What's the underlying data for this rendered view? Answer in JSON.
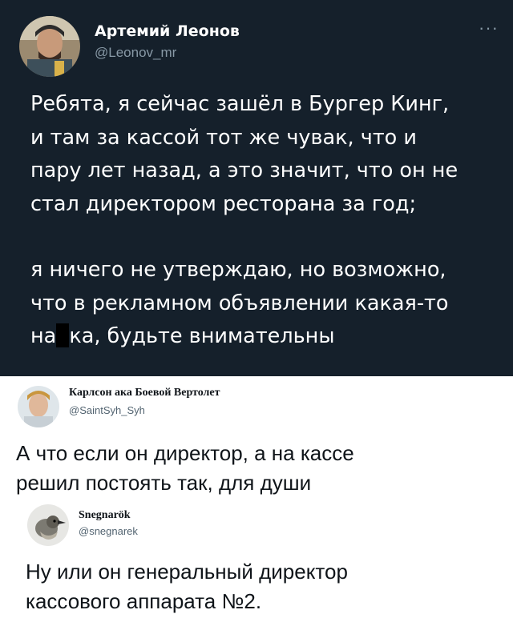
{
  "tweet": {
    "author_name": "Артемий Леонов",
    "author_handle": "@Leonov_mr",
    "menu_icon": "more-dots-icon",
    "paragraphs": [
      [
        "Ребята, я сейчас зашёл в Бургер Кинг,",
        "и там за кассой тот же чувак, что и",
        "пару лет назад, а это значит, что он не",
        "стал директором ресторана за год;"
      ],
      [
        "я ничего не утверждаю, но возможно,",
        "что в рекламном объявлении какая-то"
      ]
    ],
    "last_line_prefix": "на",
    "last_line_suffix": "ка, будьте внимательны",
    "colors": {
      "background": "#15202b",
      "text": "#ffffff",
      "muted": "#8899a6"
    }
  },
  "replies": [
    {
      "author_name": "Карлсон ака Боевой Вертолет",
      "author_handle": "@SaintSyh_Syh",
      "lines": [
        "А что если он директор, а на кассе",
        "решил постоять так, для души"
      ]
    },
    {
      "author_name": "Snegnarök",
      "author_handle": "@snegnarek",
      "lines": [
        "Ну или он генеральный директор",
        "кассового аппарата №2."
      ]
    }
  ]
}
